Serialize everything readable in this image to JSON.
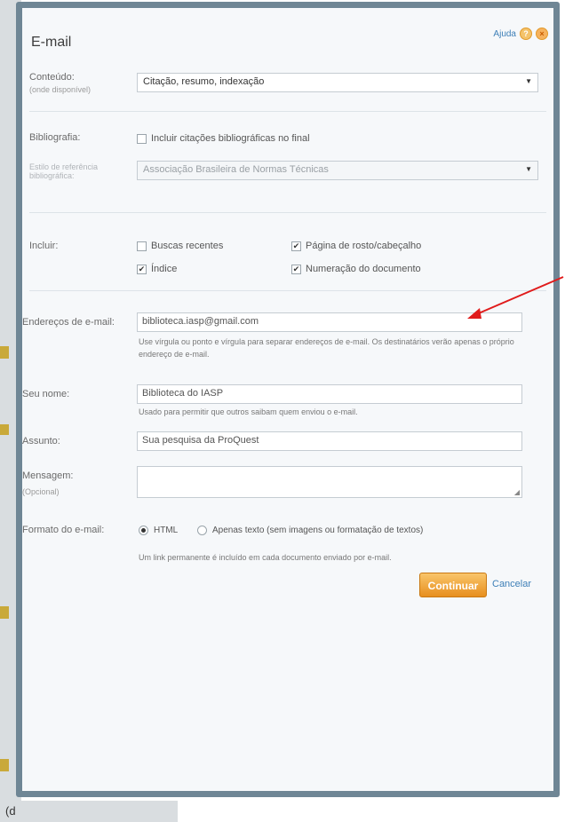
{
  "dialog": {
    "title": "E-mail",
    "help_label": "Ajuda"
  },
  "content": {
    "label": "Conteúdo:",
    "sublabel": "(onde disponível)",
    "selected": "Citação, resumo, indexação"
  },
  "bibliography": {
    "label": "Bibliografia:",
    "include_checkbox": "Incluir citações bibliográficas no final",
    "include_checked": false,
    "style_label": "Estilo de referência bibliográfica:",
    "style_selected": "Associação Brasileira de Normas Técnicas"
  },
  "include": {
    "label": "Incluir:",
    "options": [
      {
        "label": "Buscas recentes",
        "checked": false
      },
      {
        "label": "Página de rosto/cabeçalho",
        "checked": true
      },
      {
        "label": "Índice",
        "checked": true
      },
      {
        "label": "Numeração do documento",
        "checked": true
      }
    ]
  },
  "email": {
    "label": "Endereços de e-mail:",
    "value": "biblioteca.iasp@gmail.com",
    "hint": "Use vírgula ou ponto e vírgula para separar endereços de e-mail. Os destinatários verão apenas o próprio endereço de e-mail."
  },
  "name": {
    "label": "Seu nome:",
    "value": "Biblioteca do IASP",
    "hint": "Usado para permitir que outros saibam quem enviou o e-mail."
  },
  "subject": {
    "label": "Assunto:",
    "value": "Sua pesquisa da ProQuest"
  },
  "message": {
    "label": "Mensagem:",
    "sublabel": "(Opcional)",
    "value": ""
  },
  "format": {
    "label": "Formato do e-mail:",
    "options": [
      {
        "label": "HTML",
        "selected": true
      },
      {
        "label": "Apenas texto (sem imagens ou formatação de textos)",
        "selected": false
      }
    ],
    "permalink_note": "Um link permanente é incluído em cada documento enviado por e-mail."
  },
  "actions": {
    "continue_label": "Continuar",
    "cancel_label": "Cancelar"
  },
  "background": {
    "bottom_fragment": "(d"
  },
  "colors": {
    "accent": "#3d7fb7",
    "button": "#e78f1e",
    "annotation_arrow": "#e01b1b"
  }
}
